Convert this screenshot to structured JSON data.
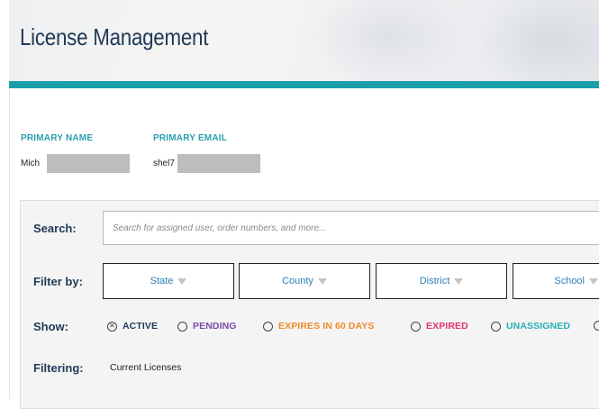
{
  "page": {
    "title": "License Management"
  },
  "primary": {
    "name_label": "PRIMARY NAME",
    "name_value": "Mich",
    "email_label": "PRIMARY EMAIL",
    "email_value": "shel7"
  },
  "search": {
    "label": "Search:",
    "placeholder": "Search for assigned user, order numbers, and more..."
  },
  "filter": {
    "label": "Filter by:",
    "options": [
      "State",
      "County",
      "District",
      "School"
    ]
  },
  "show": {
    "label": "Show:",
    "options": [
      {
        "label": "ACTIVE",
        "selected": true,
        "color": "#1f3a56"
      },
      {
        "label": "PENDING",
        "selected": false,
        "color": "#7b4aa3"
      },
      {
        "label": "EXPIRES IN 60 DAYS",
        "selected": false,
        "color": "#f08b2b"
      },
      {
        "label": "EXPIRED",
        "selected": false,
        "color": "#e5336b"
      },
      {
        "label": "UNASSIGNED",
        "selected": false,
        "color": "#2aaeb4"
      }
    ]
  },
  "filtering": {
    "label": "Filtering:",
    "value": "Current Licenses"
  },
  "colors": {
    "accent": "#1a9ea9",
    "heading": "#1f3a56",
    "label_teal": "#2a9fae",
    "select_text": "#2c7fb5"
  }
}
